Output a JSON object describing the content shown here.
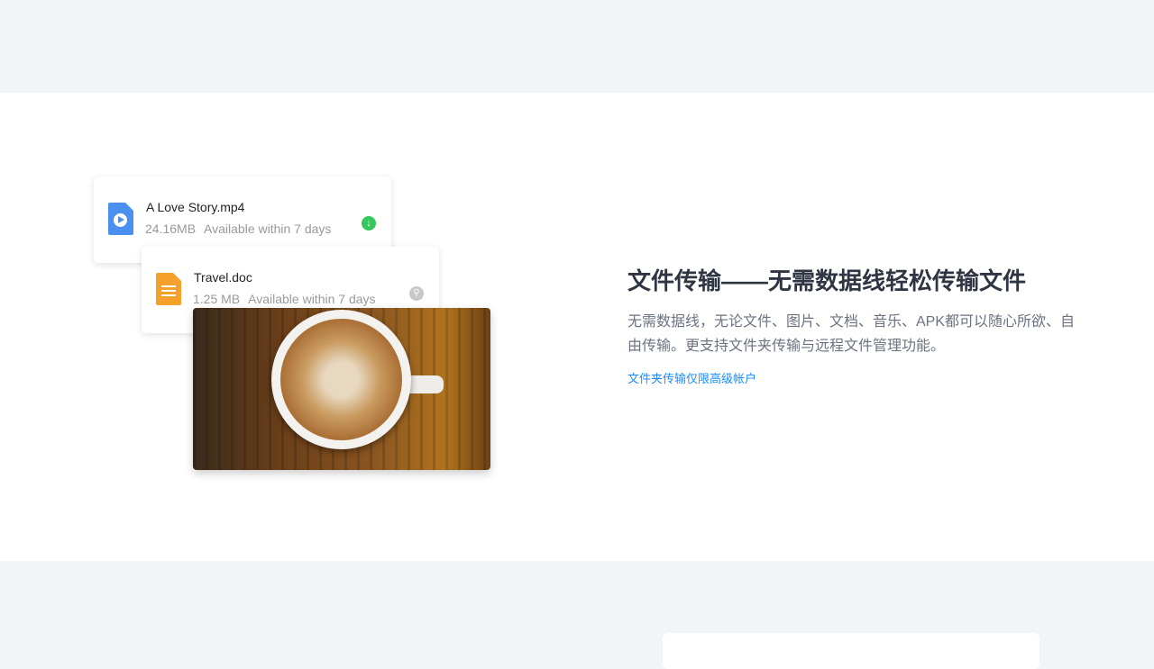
{
  "files": [
    {
      "name": "A Love Story.mp4",
      "size": "24.16MB",
      "availability": "Available within 7 days",
      "icon": "video-file-icon",
      "action": "download-icon",
      "color": "#4a90f0",
      "action_color": "#34c759"
    },
    {
      "name": "Travel.doc",
      "size": "1.25 MB",
      "availability": "Available within 7 days",
      "icon": "document-file-icon",
      "action": "search-icon",
      "color": "#f5a02a",
      "action_color": "#c8c8c8"
    }
  ],
  "feature": {
    "title": "文件传输——无需数据线轻松传输文件",
    "description": "无需数据线，无论文件、图片、文档、音乐、APK都可以随心所欲、自由传输。更支持文件夹传输与远程文件管理功能。",
    "link": "文件夹传输仅限高级帐户"
  }
}
